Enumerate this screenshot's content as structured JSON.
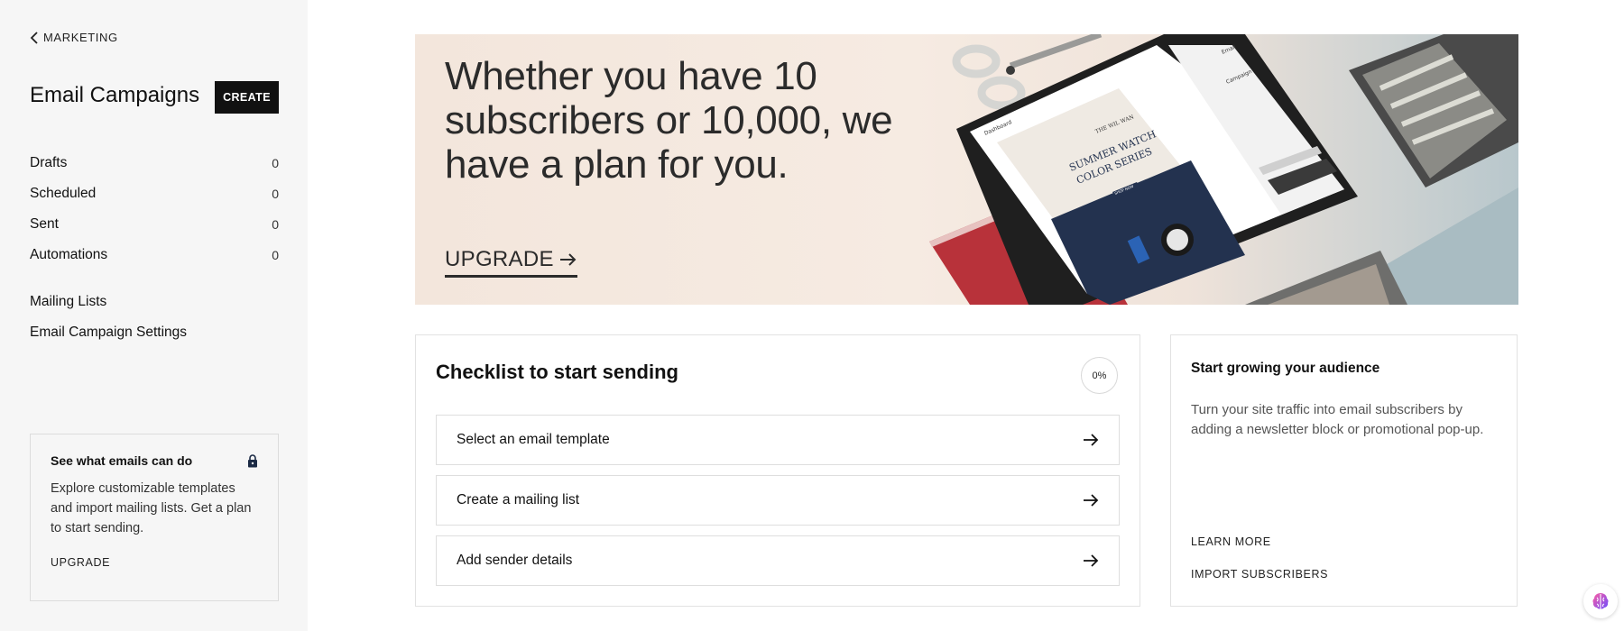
{
  "sidebar": {
    "back_label": "MARKETING",
    "title": "Email Campaigns",
    "create_label": "CREATE",
    "counts_nav": [
      {
        "label": "Drafts",
        "count": "0"
      },
      {
        "label": "Scheduled",
        "count": "0"
      },
      {
        "label": "Sent",
        "count": "0"
      },
      {
        "label": "Automations",
        "count": "0"
      }
    ],
    "links_nav": [
      {
        "label": "Mailing Lists"
      },
      {
        "label": "Email Campaign Settings"
      }
    ],
    "promo": {
      "title": "See what emails can do",
      "body": "Explore customizable templates and import mailing lists. Get a plan to start sending.",
      "link": "UPGRADE"
    }
  },
  "hero": {
    "title": "Whether you have 10 subscribers or 10,000, we have a plan for you.",
    "upgrade_label": "UPGRADE",
    "tablet_text": {
      "brand": "THE WIL WAN",
      "headline_1": "SUMMER WATCH",
      "headline_2": "COLOR SERIES",
      "cta": "SHOP NOW",
      "nav_back": "Dashboard",
      "tab_1": "Email",
      "tab_2": "Campaign"
    }
  },
  "checklist": {
    "title": "Checklist to start sending",
    "progress": "0%",
    "tasks": [
      {
        "label": "Select an email template"
      },
      {
        "label": "Create a mailing list"
      },
      {
        "label": "Add sender details"
      }
    ]
  },
  "audience": {
    "title": "Start growing your audience",
    "body": "Turn your site traffic into email subscribers by adding a newsletter block or promotional pop-up.",
    "learn_more": "LEARN MORE",
    "import": "IMPORT SUBSCRIBERS"
  },
  "icons": {
    "back": "chevron-left-icon",
    "lock": "lock-icon",
    "arrow": "arrow-right-icon",
    "help": "help-brain-icon"
  },
  "colors": {
    "sidebar_bg": "#f6f6f6",
    "button_bg": "#111111",
    "hero_bg": "#f3e6dc"
  }
}
